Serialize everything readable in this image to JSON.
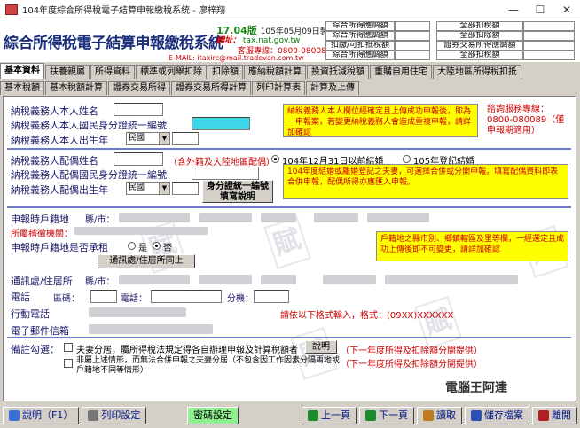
{
  "window": {
    "title": "104年度綜合所得稅電子結算申報繳稅系統 - 廖梓翔",
    "min": "—",
    "max": "☐",
    "close": "✕"
  },
  "header": {
    "app_title": "綜合所得稅電子結算申報繳稅系統",
    "version": "17.04版",
    "build_date": "105年05月09日製",
    "website_label": "網址：",
    "website": "tax.nat.gov.tw",
    "service_tel": "客服專線：0800-080089",
    "email": "E-MAIL: itaxirc@mail.tradevan.com.tw",
    "listboxes_left": [
      "綜合所得應調額",
      "綜合所得應調額",
      "扣繳/可扣抵稅額",
      "綜合所得應調額",
      "綜合所得基本額",
      "應納稅額"
    ],
    "listboxes_right": [
      "全部扣稅額",
      "全部扣除額",
      "證券交易所得應調額",
      "全部扣稅額",
      "一般所得稅額",
      "應行繳納稅額"
    ]
  },
  "tabs_row1": [
    "基本資料",
    "扶養親屬",
    "所得資料",
    "標準或列舉扣除",
    "扣除額",
    "應納稅額計算",
    "投資抵減稅額",
    "重購自用住宅",
    "大陸地區所得稅扣抵"
  ],
  "tabs_row2": [
    "基本稅額",
    "基本稅額計算",
    "證券交易所得",
    "證券交易所得計算",
    "列印計算表",
    "計算及上傳"
  ],
  "form": {
    "taxpayer_name": "納稅義務人本人姓名",
    "taxpayer_id": "納稅義務人本人國民身分證統一編號",
    "taxpayer_birth": "納稅義務人本人出生年",
    "era_option": "民國",
    "notice1": "納稅義務人本人欄位經確定且上傳成功申報後，即為一申報案，若變更納稅義務人會造成重複申報，請詳加確認",
    "service_note": "諮詢服務專線：0800-080089（僅申報期適用）",
    "spouse_name": "納稅義務人配偶姓名",
    "spouse_note": "（含外籍及大陸地區配偶）",
    "marriage_before": "104年12月31日以前結婚",
    "marriage_2016": "105年登記結婚",
    "spouse_id": "納稅義務人配偶國民身分證統一編號",
    "spouse_birth": "納稅義務人配偶出生年",
    "id_btn": "身分證統一編號填寫說明",
    "notice2": "104年度結婚或離婚登記之夫妻，可選擇合併或分開申報。填寫配偶資料即表合併申報，配偶所得亦應匯入申報。",
    "reg_addr": "申報時戶籍地",
    "county": "縣/市：",
    "lease": "所屬稽徵機關：",
    "reg_addr_rent": "申報時戶籍地是否承租",
    "yes": "是",
    "no": "否",
    "notice3": "戶籍地之縣市別、鄉鎮轄區及里等欄，一經選定且成功上傳後即不可變更，請詳加確認",
    "same_btn": "通訊處/住居所同上",
    "mail_addr": "通訊處/住居所",
    "phone": "電話",
    "area_code": "區碼：",
    "phone_label": "電話：",
    "ext": "分機：",
    "mobile": "行動電話",
    "mobile_hint": "請依以下格式輸入，格式：(09XX)XXXXXX",
    "email": "電子郵件信箱",
    "notes_label": "備註勾選：",
    "opt1": "夫妻分居，屬所得稅法規定得各自辦理申報及計算稅額者",
    "explain": "說明",
    "opt1_note": "（下一年度所得及扣除額分開提供）",
    "opt2": "非屬上述情形，而無法合併申報之夫妻分居（不包含因工作因素分隔兩地或戶籍地不同等情形）",
    "opt2_note": "（下一年度所得及扣除額分開提供）"
  },
  "bottom": {
    "help": "說明（F1）",
    "print": "列印設定",
    "password": "密碼設定",
    "prev": "上一頁",
    "next": "下一頁",
    "read": "讀取",
    "save": "儲存檔案",
    "exit": "離開"
  },
  "logo_text": "電腦王阿達"
}
